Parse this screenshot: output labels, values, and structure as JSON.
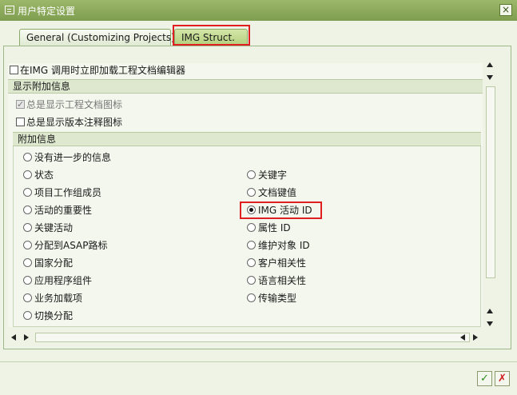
{
  "window": {
    "title": "用户特定设置",
    "close_label": "×"
  },
  "tabs": [
    {
      "label": "General (Customizing Projects)"
    },
    {
      "label": "IMG Struct."
    }
  ],
  "top_checkbox": {
    "label": "在IMG 调用时立即加载工程文档编辑器",
    "checked": false
  },
  "section_display": {
    "title": "显示附加信息",
    "options": [
      {
        "label": "总是显示工程文档图标",
        "checked": true,
        "disabled": true
      },
      {
        "label": "总是显示版本注释图标",
        "checked": false
      }
    ]
  },
  "additional_info": {
    "title": "附加信息",
    "left": [
      "没有进一步的信息",
      "状态",
      "项目工作组成员",
      "活动的重要性",
      "关键活动",
      "分配到ASAP路标",
      "国家分配",
      "应用程序组件",
      "业务加载项",
      "切换分配"
    ],
    "right": [
      "关键字",
      "文档键值",
      "IMG 活动 ID",
      "属性 ID",
      "维护对象 ID",
      "客户相关性",
      "语言相关性",
      "传输类型"
    ],
    "selected": "IMG 活动 ID"
  },
  "footer": {
    "ok_symbol": "✓",
    "cancel_symbol": "✗"
  },
  "colors": {
    "title_bar": "#8aa85a",
    "highlight": "#e02020",
    "background": "#eef3e6"
  }
}
